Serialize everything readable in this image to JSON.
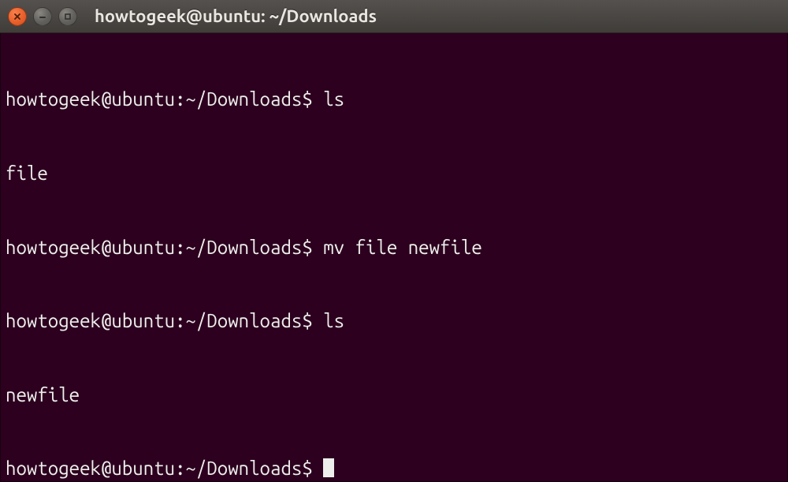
{
  "window": {
    "title": "howtogeek@ubuntu: ~/Downloads"
  },
  "prompt": "howtogeek@ubuntu:~/Downloads$ ",
  "session": {
    "lines": [
      {
        "prompt": true,
        "text": "ls"
      },
      {
        "prompt": false,
        "text": "file"
      },
      {
        "prompt": true,
        "text": "mv file newfile"
      },
      {
        "prompt": true,
        "text": "ls"
      },
      {
        "prompt": false,
        "text": "newfile"
      },
      {
        "prompt": true,
        "text": "",
        "cursor": true
      }
    ]
  },
  "icons": {
    "close": "close-icon",
    "minimize": "minimize-icon",
    "maximize": "maximize-icon"
  }
}
